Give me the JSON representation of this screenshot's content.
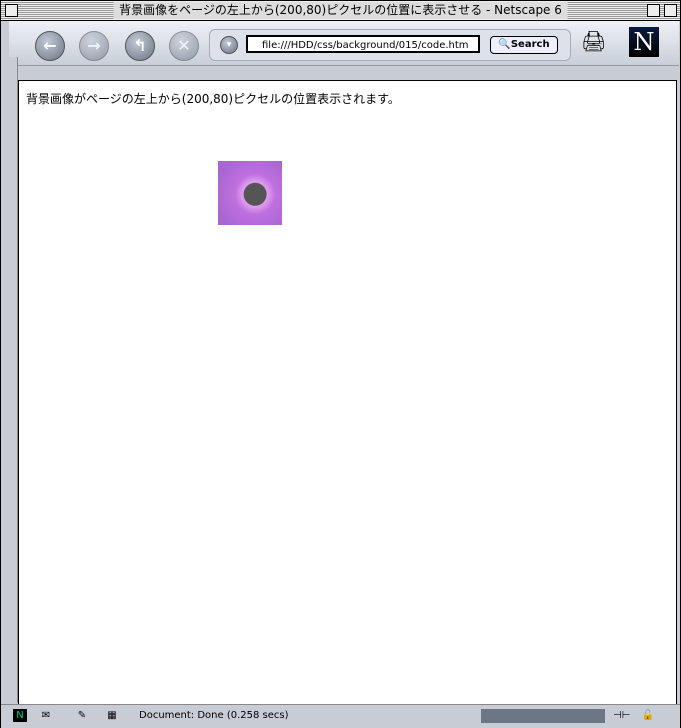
{
  "window": {
    "title": "背景画像をページの左上から(200,80)ピクセルの位置に表示させる - Netscape 6"
  },
  "toolbar": {
    "url": "file:///HDD/css/background/015/code.htm",
    "search_label": "Search",
    "logo": "N"
  },
  "content": {
    "text": "背景画像がページの左上から(200,80)ピクセルの位置表示されます。"
  },
  "status": {
    "text": "Document: Done (0.258 secs)"
  }
}
